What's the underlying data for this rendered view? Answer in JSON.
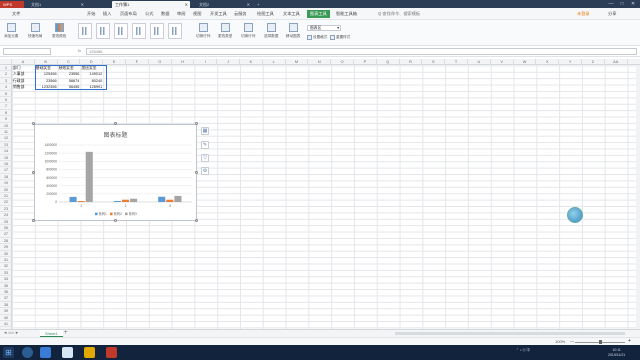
{
  "titlebar": {
    "app_tab": "WPS",
    "doc_tab_1": "文档1",
    "doc_tab_active": "工作簿1",
    "doc_tab_3": "文档2",
    "add_tab": "+",
    "min": "—",
    "max": "□",
    "close": "✕"
  },
  "menubar": {
    "items": [
      "文件",
      "开始",
      "插入",
      "页面布局",
      "公式",
      "数据",
      "审阅",
      "视图",
      "开发工具",
      "云服务",
      "绘图工具",
      "文本工具",
      "图表工具",
      "智能工具箱"
    ],
    "highlighted": "图表工具",
    "search": "Q 查找命令、搜索模板",
    "login": "未登录",
    "share": "分享"
  },
  "ribbon": {
    "add_element": "添加元素",
    "quick_layout": "快速布局",
    "change_color": "更改颜色",
    "switch_row_col": "切换行列",
    "select_data": "选择数据",
    "move_chart": "移动图表",
    "change_type": "更改类型",
    "chart_area_select": "图表区",
    "format_selection": "设置格式",
    "reset_style": "重置样式"
  },
  "formula_bar": {
    "name_box": "",
    "fx": "fx",
    "value": "125456"
  },
  "columns": [
    "A",
    "B",
    "C",
    "D",
    "E",
    "F",
    "G",
    "H",
    "I",
    "J",
    "K",
    "L",
    "M",
    "N",
    "O",
    "P",
    "Q",
    "R",
    "S",
    "T",
    "U",
    "V",
    "W",
    "X",
    "Y",
    "Z",
    "AA"
  ],
  "rows": [
    "1",
    "2",
    "3",
    "4",
    "5",
    "6",
    "7",
    "8",
    "9",
    "10",
    "11",
    "12",
    "13",
    "14",
    "15",
    "16",
    "17",
    "18",
    "19",
    "20",
    "21",
    "22",
    "23",
    "24",
    "25",
    "26",
    "27",
    "28",
    "29",
    "30",
    "31",
    "32",
    "33",
    "34",
    "35",
    "36",
    "37",
    "38",
    "39",
    "40",
    "41"
  ],
  "table": {
    "header": [
      "部门",
      "基础奖金",
      "绩效奖金",
      "加班奖金"
    ],
    "rows": [
      [
        "人事部",
        "125456",
        "23556",
        "149012"
      ],
      [
        "行政部",
        "23566",
        "56674",
        "80240"
      ],
      [
        "销售部",
        "1232456",
        "56456",
        "128991"
      ]
    ]
  },
  "chart_data": {
    "type": "bar",
    "title": "图表标题",
    "categories": [
      "1",
      "2",
      "3"
    ],
    "series": [
      {
        "name": "系列1",
        "values": [
          125456,
          23566,
          128991
        ],
        "color": "#5b9bd5"
      },
      {
        "name": "系列2",
        "values": [
          23556,
          56674,
          56456
        ],
        "color": "#ed7d31"
      },
      {
        "name": "系列3",
        "values": [
          1232456,
          80240,
          149012
        ],
        "color": "#a5a5a5"
      }
    ],
    "yticks": [
      "0",
      "200000",
      "400000",
      "600000",
      "800000",
      "1000000",
      "1200000",
      "1400000"
    ],
    "ylim": [
      0,
      1400000
    ],
    "legend": "bottom",
    "grid": true
  },
  "chart_tools": [
    "▦",
    "✎",
    "▽",
    "⚙"
  ],
  "sheetbar": {
    "sheet": "Sheet1",
    "add": "+"
  },
  "statusbar": {
    "zoom": "100%",
    "zoom_minus": "—",
    "zoom_plus": "+"
  },
  "taskbar": {
    "time": "10:11",
    "date": "2019/11/21"
  },
  "colors": {
    "accent": "#2e8b57",
    "chart_tools_tab": "#3a9a56",
    "title_bg": "#2c3e55",
    "taskbar_bg": "#12233d"
  }
}
